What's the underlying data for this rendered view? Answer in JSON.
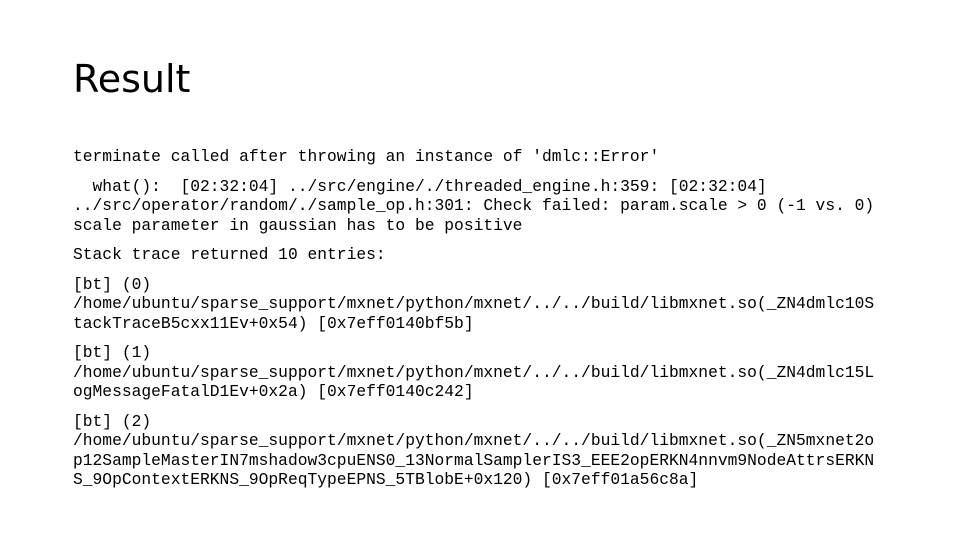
{
  "slide": {
    "title": "Result",
    "paragraphs": [
      {
        "lines": [
          "terminate called after throwing an instance of 'dmlc::Error'"
        ]
      },
      {
        "lines": [
          "  what():  [02:32:04] ../src/engine/./threaded_engine.h:359: [02:32:04]",
          "../src/operator/random/./sample_op.h:301: Check failed: param.scale > 0 (-1 vs. 0)",
          "scale parameter in gaussian has to be positive"
        ]
      },
      {
        "lines": [
          "Stack trace returned 10 entries:"
        ]
      },
      {
        "lines": [
          "[bt] (0)",
          "/home/ubuntu/sparse_support/mxnet/python/mxnet/../../build/libmxnet.so(_ZN4dmlc10S",
          "tackTraceB5cxx11Ev+0x54) [0x7eff0140bf5b]"
        ]
      },
      {
        "lines": [
          "[bt] (1)",
          "/home/ubuntu/sparse_support/mxnet/python/mxnet/../../build/libmxnet.so(_ZN4dmlc15L",
          "ogMessageFatalD1Ev+0x2a) [0x7eff0140c242]"
        ]
      },
      {
        "lines": [
          "[bt] (2)",
          "/home/ubuntu/sparse_support/mxnet/python/mxnet/../../build/libmxnet.so(_ZN5mxnet2o",
          "p12SampleMasterIN7mshadow3cpuENS0_13NormalSamplerIS3_EEE2opERKN4nnvm9NodeAttrsERKN",
          "S_9OpContextERKNS_9OpReqTypeEPNS_5TBlobE+0x120) [0x7eff01a56c8a]"
        ]
      }
    ]
  }
}
